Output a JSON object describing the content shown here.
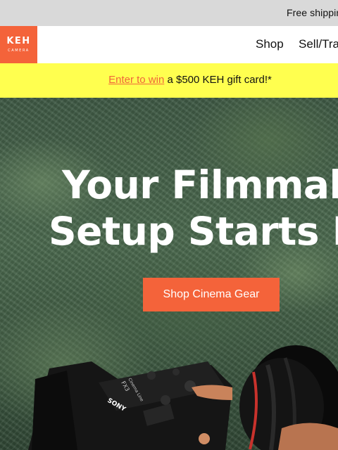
{
  "announcement": {
    "text": "Free shippin"
  },
  "header": {
    "logo_main": "KEH",
    "logo_sub": "CAMERA",
    "nav": [
      {
        "label": "Shop"
      },
      {
        "label": "Sell/Tra"
      }
    ]
  },
  "promo": {
    "link_text": "Enter to win",
    "rest_text": " a $500 KEH gift card!*"
  },
  "hero": {
    "title_line_1": "Your Filmmakin",
    "title_line_2": "Setup Starts Her",
    "cta_label": "Shop Cinema Gear",
    "camera_brand": "SONY",
    "camera_model": "Cinema Line",
    "camera_model_code": "FX3"
  },
  "colors": {
    "brand_orange": "#f4633a",
    "promo_yellow": "#ffff4f",
    "top_strip_gray": "#d9d9d9"
  }
}
